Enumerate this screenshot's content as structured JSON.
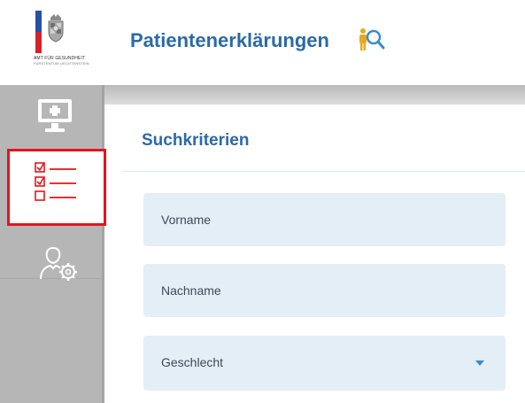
{
  "header": {
    "logo_line1": "AMT FÜR GESUNDHEIT",
    "logo_line2": "FÜRSTENTUM LIECHTENSTEIN",
    "app_title": "Patientenerklärungen"
  },
  "sidebar": {
    "items": [
      {
        "icon": "monitor-plus-icon",
        "active": false
      },
      {
        "icon": "checklist-icon",
        "active": true
      },
      {
        "icon": "user-settings-icon",
        "active": false
      }
    ]
  },
  "main": {
    "section_title": "Suchkriterien",
    "fields": [
      {
        "label": "Vorname",
        "type": "text"
      },
      {
        "label": "Nachname",
        "type": "text"
      },
      {
        "label": "Geschlecht",
        "type": "select"
      }
    ]
  },
  "colors": {
    "brand_blue": "#2c6aa6",
    "highlight_red": "#e5141c",
    "field_bg": "#e3eef7",
    "sidebar_gray": "#b6b6b6"
  }
}
